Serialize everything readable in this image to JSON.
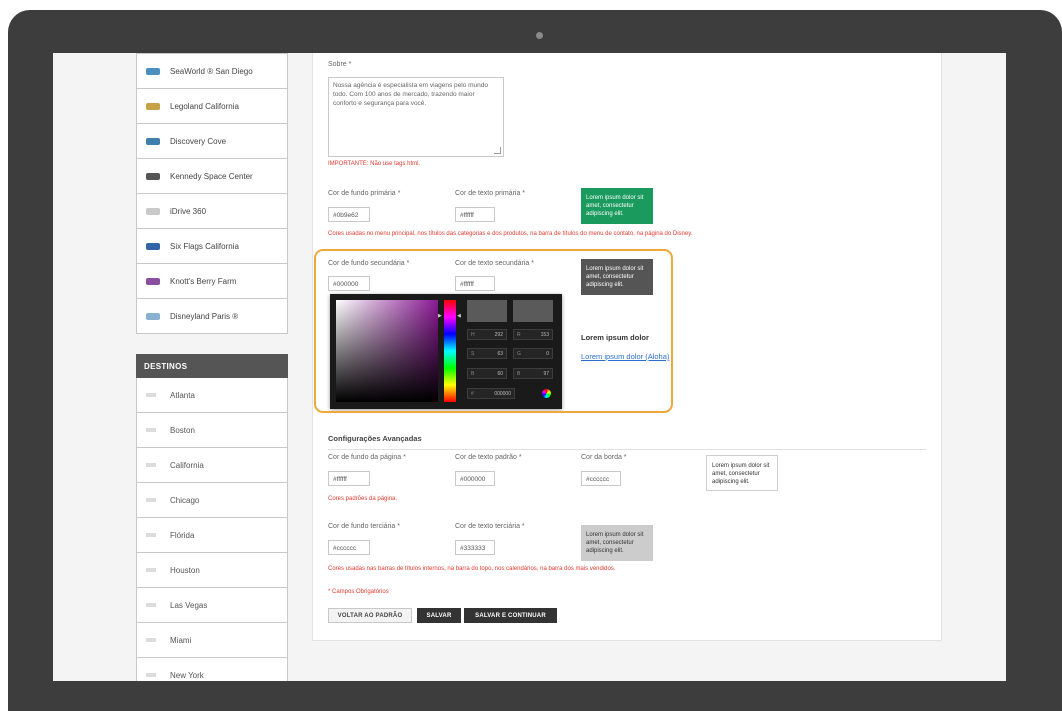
{
  "sidebar": {
    "parks": [
      {
        "label": "SeaWorld ® San Diego",
        "color": "#4a8fbf"
      },
      {
        "label": "Legoland California",
        "color": "#c7a146"
      },
      {
        "label": "Discovery Cove",
        "color": "#3f7fae"
      },
      {
        "label": "Kennedy Space Center",
        "color": "#555555"
      },
      {
        "label": "iDrive 360",
        "color": "#c9c9c9"
      },
      {
        "label": "Six Flags California",
        "color": "#3464a8"
      },
      {
        "label": "Knott's Berry Farm",
        "color": "#8a4fa0"
      },
      {
        "label": "Disneyland Paris ®",
        "color": "#8ab0d0"
      }
    ],
    "destinos_header": "DESTINOS",
    "destinos": [
      "Atlanta",
      "Boston",
      "California",
      "Chicago",
      "Flórida",
      "Houston",
      "Las Vegas",
      "Miami",
      "New York"
    ]
  },
  "form": {
    "sobre": {
      "label": "Sobre *",
      "value": "Nossa agência é especialista em viagens pelo mundo todo. Com 100 anos de mercado, trazendo maior conforto e segurança para você.",
      "note": "IMPORTANTE: Não use tags html."
    },
    "primary": {
      "bg_label": "Cor de fundo primária *",
      "bg_value": "#0b9e62",
      "text_label": "Cor de texto primária *",
      "text_value": "#ffffff",
      "preview_text": "Lorem ipsum dolor sit amet, consectetur adipiscing elit.",
      "preview_bg": "#1a9a5c",
      "preview_color": "#ffffff",
      "note": "Cores usadas no menu principal, nos títulos das categorias e dos produtos, na barra de títulos do menu de contato, na página do Disney."
    },
    "secondary": {
      "bg_label": "Cor de fundo secundária *",
      "bg_value": "#000000",
      "text_label": "Cor de texto secundária *",
      "text_value": "#ffffff",
      "preview_text": "Lorem ipsum dolor sit amet, consectetur adipiscing elit.",
      "preview_bg": "#555555",
      "preview_color": "#ffffff",
      "lorem_title": "Lorem ipsum dolor",
      "lorem_link": "Lorem ipsum dolor (Aloha)"
    },
    "picker": {
      "fields": [
        {
          "key": "H",
          "value": "292"
        },
        {
          "key": "R",
          "value": "153"
        },
        {
          "key": "S",
          "value": "63"
        },
        {
          "key": "G",
          "value": "0"
        },
        {
          "key": "B",
          "value": "60"
        },
        {
          "key": "B",
          "value": "97"
        },
        {
          "key": "#",
          "value": "000000"
        }
      ]
    },
    "advanced": {
      "title": "Configurações Avançadas",
      "page_bg_label": "Cor de fundo da página *",
      "page_bg_value": "#ffffff",
      "default_text_label": "Cor de texto padrão *",
      "default_text_value": "#000000",
      "border_label": "Cor da borda *",
      "border_value": "#cccccc",
      "preview_text": "Lorem ipsum dolor sit amet, consectetur adipiscing elit.",
      "page_note": "Cores padrões da página.",
      "tertiary_bg_label": "Cor de fundo terciária *",
      "tertiary_bg_value": "#cccccc",
      "tertiary_text_label": "Cor de texto terciária *",
      "tertiary_text_value": "#333333",
      "tertiary_preview_text": "Lorem ipsum dolor sit amet, consectetur adipiscing elit.",
      "tertiary_note": "Cores usadas nas barras de títulos internos, na barra do topo, nos calendários, na barra dos mais vendidos."
    },
    "required_note": "* Campos Obrigatórios",
    "buttons": {
      "reset": "VOLTAR AO PADRÃO",
      "save": "SALVAR",
      "save_continue": "SALVAR E CONTINUAR"
    }
  },
  "colors": {
    "note_red": "#e23b2f",
    "highlight": "#f0a83a",
    "bezel": "#3d3d3d"
  }
}
